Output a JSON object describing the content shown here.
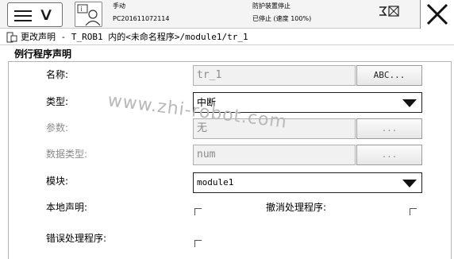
{
  "status": {
    "mode": "手动",
    "controller_id": "PC201611072114",
    "safety": "防护装置停止",
    "run_state": "已停止 (速度 100%)"
  },
  "breadcrumb": "更改声明 - T_ROB1 内的<未命名程序>/module1/tr_1",
  "section_title": "例行程序声明",
  "form": {
    "name": {
      "label": "名称:",
      "value": "tr_1",
      "button": "ABC..."
    },
    "type": {
      "label": "类型:",
      "value": "中断"
    },
    "params": {
      "label": "参数:",
      "value": "无",
      "button": "..."
    },
    "datatype": {
      "label": "数据类型:",
      "value": "num",
      "button": "..."
    },
    "module": {
      "label": "模块:",
      "value": "module1"
    },
    "local": {
      "label": "本地声明:"
    },
    "undo": {
      "label": "撤消处理程序:"
    },
    "error": {
      "label": "错误处理程序:"
    }
  },
  "watermark": "www.zhi-robot.com",
  "icons": {
    "menu": "hamburger-menu-icon",
    "robot": "robot-info-icon",
    "close": "close-icon",
    "status": "system-status-icon"
  }
}
